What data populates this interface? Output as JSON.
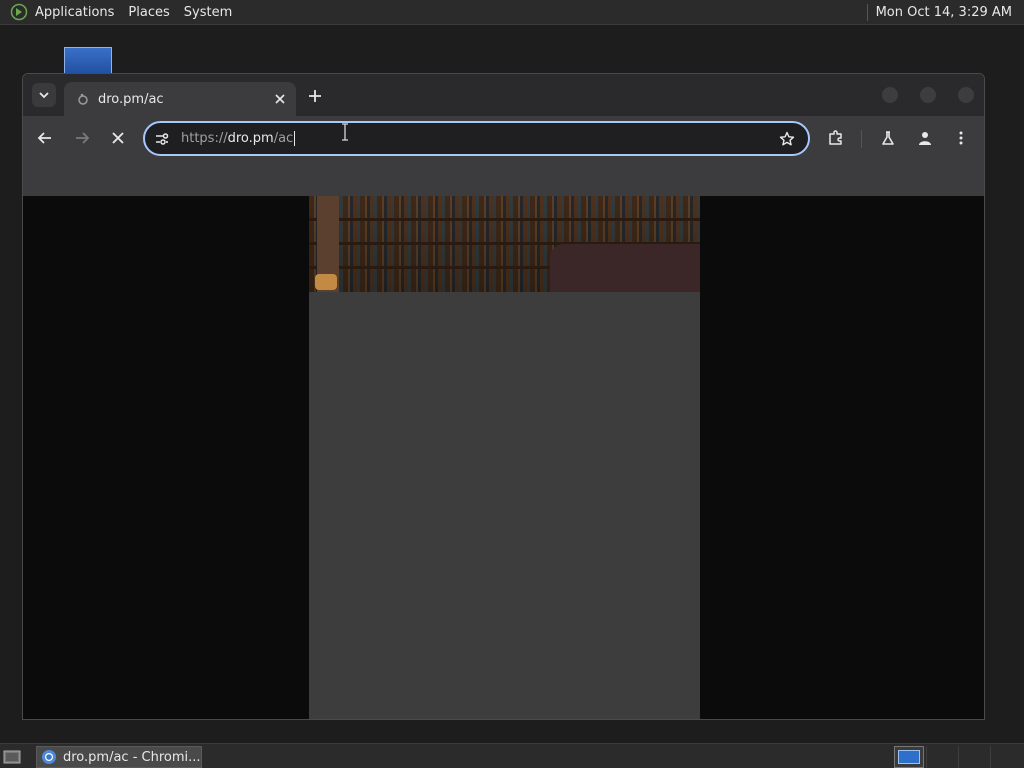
{
  "top_panel": {
    "menus": [
      "Applications",
      "Places",
      "System"
    ],
    "clock": "Mon Oct 14,  3:29 AM"
  },
  "browser": {
    "tab": {
      "title": "dro.pm/ac",
      "close_icon": "close-icon"
    },
    "new_tab_icon": "plus-icon",
    "omnibox": {
      "scheme": "https://",
      "host": "dro.pm",
      "path": "/ac"
    },
    "toolbar_icons": [
      "back-icon",
      "forward-icon",
      "stop-icon",
      "site-info-icon",
      "star-icon",
      "extensions-icon",
      "labs-icon",
      "profile-icon",
      "menu-icon"
    ]
  },
  "taskbar": {
    "window_label": "dro.pm/ac - Chromi..."
  },
  "colors": {
    "accent": "#a8c7fa",
    "panel": "#2b2b2b",
    "toolbar": "#3c3c3f"
  }
}
